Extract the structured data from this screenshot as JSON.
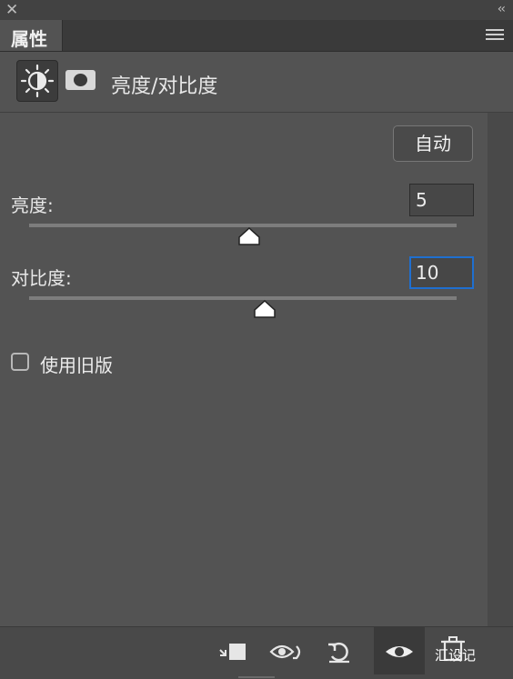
{
  "titlebar": {
    "close_icon": "close-icon",
    "collapse_glyph": "‹‹"
  },
  "panel": {
    "tab_label": "属性",
    "menu_icon": "panel-menu-icon"
  },
  "header": {
    "adjustment_icon": "brightness-contrast-icon",
    "mask_icon": "layer-mask-icon",
    "title": "亮度/对比度"
  },
  "controls": {
    "auto_label": "自动",
    "brightness": {
      "label": "亮度:",
      "value": "5",
      "slider_fraction": 0.515
    },
    "contrast": {
      "label": "对比度:",
      "value": "10",
      "slider_fraction": 0.55
    },
    "legacy": {
      "label": "使用旧版",
      "checked": false
    }
  },
  "footer": {
    "icons": [
      "clip-to-layer-icon",
      "view-previous-state-icon",
      "reset-icon",
      "toggle-visibility-icon",
      "delete-icon"
    ],
    "watermark": "汇设记"
  },
  "colors": {
    "panel_bg": "#535353",
    "focus_border": "#1f6fd0"
  }
}
